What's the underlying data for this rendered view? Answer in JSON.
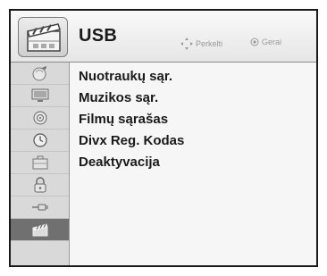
{
  "header": {
    "title": "USB",
    "hints": {
      "move_label": "Perkelti",
      "ok_label": "Gerai"
    }
  },
  "sidebar": {
    "items": [
      {
        "icon": "picture-icon"
      },
      {
        "icon": "screen-icon"
      },
      {
        "icon": "speaker-icon"
      },
      {
        "icon": "clock-icon"
      },
      {
        "icon": "toolbox-icon"
      },
      {
        "icon": "lock-icon"
      },
      {
        "icon": "plug-icon"
      },
      {
        "icon": "usb-clapper-icon",
        "active": true
      }
    ]
  },
  "menu": {
    "items": [
      {
        "label": "Nuotraukų sąr."
      },
      {
        "label": "Muzikos sąr."
      },
      {
        "label": "Filmų sąrašas"
      },
      {
        "label": "Divx Reg. Kodas"
      },
      {
        "label": "Deaktyvacija"
      }
    ]
  }
}
